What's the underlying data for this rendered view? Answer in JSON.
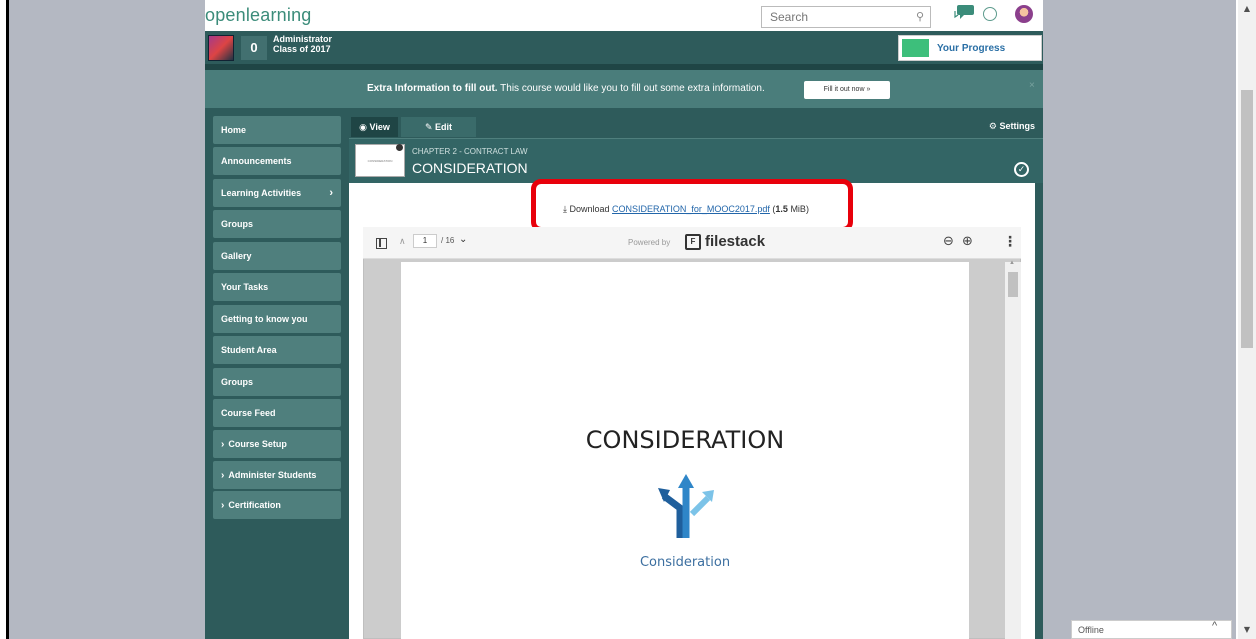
{
  "app": {
    "logo": "openlearning",
    "search_placeholder": "Search"
  },
  "user": {
    "points": "0",
    "name_line1": "Administrator",
    "name_line2": "Class of 2017",
    "progress_label": "Your Progress"
  },
  "banner": {
    "bold": "Extra Information to fill out.",
    "text": " This course would like you to fill out some extra information.",
    "button": "Fill it out now »",
    "close": "×"
  },
  "sidebar": {
    "items": [
      {
        "label": "Home"
      },
      {
        "label": "Announcements"
      },
      {
        "label": "Learning Activities"
      },
      {
        "label": "Groups"
      },
      {
        "label": "Gallery"
      },
      {
        "label": "Your Tasks"
      },
      {
        "label": "Getting to know you"
      },
      {
        "label": "Student Area"
      },
      {
        "label": "Groups"
      },
      {
        "label": "Course Feed"
      },
      {
        "label": "Course Setup"
      },
      {
        "label": "Administer Students"
      },
      {
        "label": "Certification"
      }
    ]
  },
  "tabs": {
    "view": "View",
    "edit": "Edit",
    "settings": "Settings"
  },
  "page": {
    "chapter": "CHAPTER 2 - CONTRACT LAW",
    "title": "CONSIDERATION",
    "thumb_text": "CONSIDERATION"
  },
  "download": {
    "prefix": "Download ",
    "filename": "CONSIDERATION_for_MOOC2017.pdf",
    "size_open": " (",
    "size_value": "1.5",
    "size_rest": " MiB)"
  },
  "viewer": {
    "page_current": "1",
    "page_total": "/ 16",
    "powered_by": "Powered by",
    "brand": "filestack",
    "doc_title": "CONSIDERATION",
    "doc_caption": "Consideration"
  },
  "chat": {
    "status": "Offline"
  },
  "colors": {
    "brand_teal": "#2e5b5b",
    "nav_item": "#4f7f7d",
    "highlight": "#e8000b",
    "progress": "#3dbf7b"
  }
}
